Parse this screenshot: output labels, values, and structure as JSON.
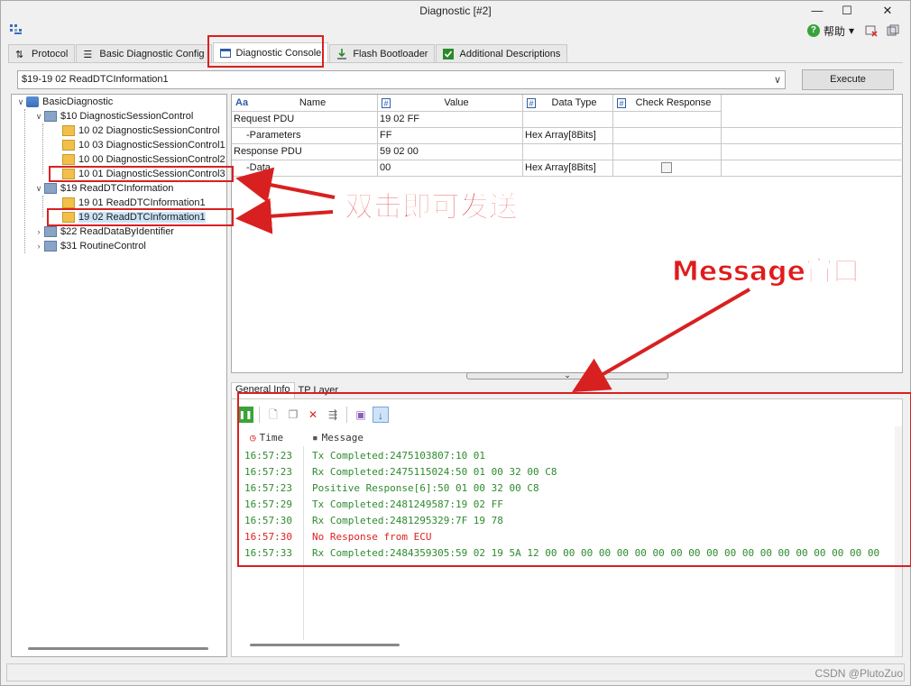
{
  "window": {
    "title": "Diagnostic [#2]",
    "minimize": "—",
    "maximize": "☐",
    "close": "✕"
  },
  "toolbar": {
    "help_label": "帮助",
    "help_arrow": "▾"
  },
  "tabs": [
    {
      "label": "Protocol",
      "icon": "sort-icon"
    },
    {
      "label": "Basic Diagnostic Config",
      "icon": "list-icon"
    },
    {
      "label": "Diagnostic Console",
      "icon": "console-icon",
      "active": true
    },
    {
      "label": "Flash Bootloader",
      "icon": "download-icon"
    },
    {
      "label": "Additional Descriptions",
      "icon": "checkbox-icon"
    }
  ],
  "command": {
    "selected": "$19-19 02 ReadDTCInformation1",
    "execute_label": "Execute"
  },
  "tree": {
    "root": "BasicDiagnostic",
    "nodes": [
      {
        "label": "$10 DiagnosticSessionControl",
        "level": 1
      },
      {
        "label": "10 02 DiagnosticSessionControl",
        "level": 2
      },
      {
        "label": "10 03 DiagnosticSessionControl1",
        "level": 2
      },
      {
        "label": "10 00 DiagnosticSessionControl2",
        "level": 2
      },
      {
        "label": "10 01 DiagnosticSessionControl3",
        "level": 2
      },
      {
        "label": "$19 ReadDTCInformation",
        "level": 1
      },
      {
        "label": "19 01 ReadDTCInformation1",
        "level": 2
      },
      {
        "label": "19 02 ReadDTCInformation1",
        "level": 2,
        "selected": true
      },
      {
        "label": "$22 ReadDataByIdentifier",
        "level": 1
      },
      {
        "label": "$31 RoutineControl",
        "level": 1
      }
    ]
  },
  "grid": {
    "headers": {
      "name": "Name",
      "value": "Value",
      "data_type": "Data Type",
      "check": "Check Response",
      "aa": "Aa",
      "hash": "#"
    },
    "rows": [
      {
        "name": "Request PDU",
        "value": "19 02 FF",
        "type": "",
        "check": false
      },
      {
        "name": "-Parameters",
        "value": "FF",
        "type": "Hex Array[8Bits]",
        "check": false
      },
      {
        "name": "Response PDU",
        "value": "59 02 00",
        "type": "",
        "check": false
      },
      {
        "name": "-Data",
        "value": "00",
        "type": "Hex Array[8Bits]",
        "check": true
      }
    ]
  },
  "bottom_tabs": [
    "General Info",
    "TP Layer"
  ],
  "messages": {
    "head_time": "Time",
    "head_message": "Message",
    "lines": [
      {
        "time": "16:57:23",
        "text": "Tx Completed:2475103807:10 01",
        "color": "#2e8b2e"
      },
      {
        "time": "16:57:23",
        "text": "Rx Completed:2475115024:50 01 00 32 00 C8",
        "color": "#2e8b2e"
      },
      {
        "time": "16:57:23",
        "text": "Positive Response[6]:50 01 00 32 00 C8",
        "color": "#2e8b2e"
      },
      {
        "time": "16:57:29",
        "text": "Tx Completed:2481249587:19 02 FF",
        "color": "#2e8b2e"
      },
      {
        "time": "16:57:30",
        "text": "Rx Completed:2481295329:7F 19 78",
        "color": "#2e8b2e"
      },
      {
        "time": "16:57:30",
        "text": "No Response from ECU",
        "color": "#e02020"
      },
      {
        "time": "16:57:33",
        "text": "Rx Completed:2484359305:59 02 19 5A 12 00 00 00 00 00 00 00 00 00 00 00 00 00 00 00 00 00 00 00",
        "color": "#2e8b2e"
      }
    ]
  },
  "annotations": {
    "double_click": "双击即可发送",
    "message_window": "Message窗口"
  },
  "watermark": "CSDN @PlutoZuo",
  "colors": {
    "annotation_red": "#d92020",
    "msg_green": "#2e8b2e",
    "msg_red": "#e02020"
  }
}
